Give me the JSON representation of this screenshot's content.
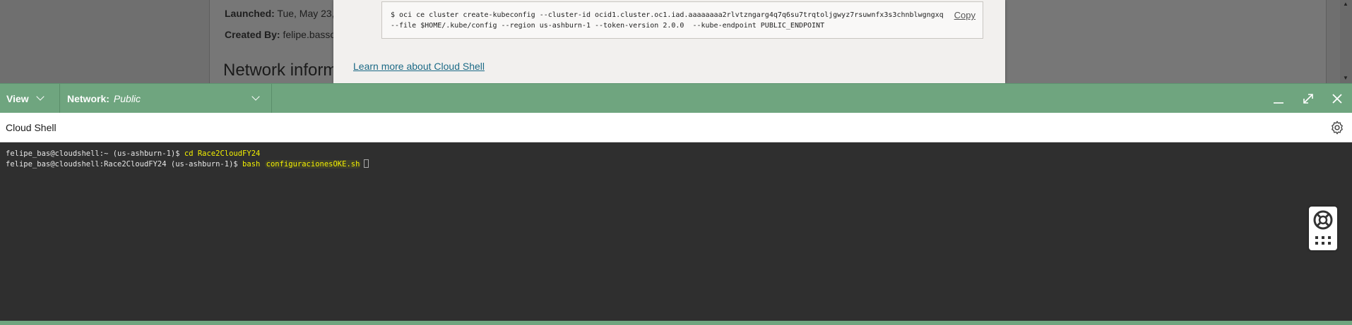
{
  "background": {
    "launched_label": "Launched:",
    "launched_value": "Tue, May 23,",
    "created_by_label": "Created By:",
    "created_by_value": "felipe.basso",
    "section_heading": "Network inform"
  },
  "modal": {
    "code_line1": "$ oci ce cluster create-kubeconfig --cluster-id ocid1.cluster.oc1.iad.aaaaaaaa2rlvtzngarg4q7q6su7trqtoljgwyz7rsuwnfx3s3chnblwgngxq",
    "code_line2": "--file $HOME/.kube/config --region us-ashburn-1 --token-version 2.0.0  --kube-endpoint PUBLIC_ENDPOINT",
    "copy_label": "Copy",
    "learn_more_label": "Learn more about Cloud Shell"
  },
  "toolbar": {
    "view_label": "View",
    "network_label": "Network:",
    "network_value": "Public"
  },
  "shell": {
    "title": "Cloud Shell"
  },
  "terminal": {
    "line1_prompt": "felipe_bas@cloudshell:~ (us-ashburn-1)$ ",
    "line1_cmd": "cd Race2CloudFY24",
    "line2_prompt": "felipe_bas@cloudshell:Race2CloudFY24 (us-ashburn-1)$ ",
    "line2_cmd_a": "bash ",
    "line2_cmd_b": "configuracionesOKE.sh"
  },
  "colors": {
    "toolbar_green": "#6fa57f",
    "terminal_bg": "#2f2f2f",
    "command_highlight": "#f3f000",
    "link_blue": "#1c6a86"
  },
  "icons": [
    "chevron-down-icon",
    "minimize-icon",
    "maximize-icon",
    "close-icon",
    "gear-icon",
    "lifebuoy-help-icon",
    "apps-grid-icon"
  ]
}
